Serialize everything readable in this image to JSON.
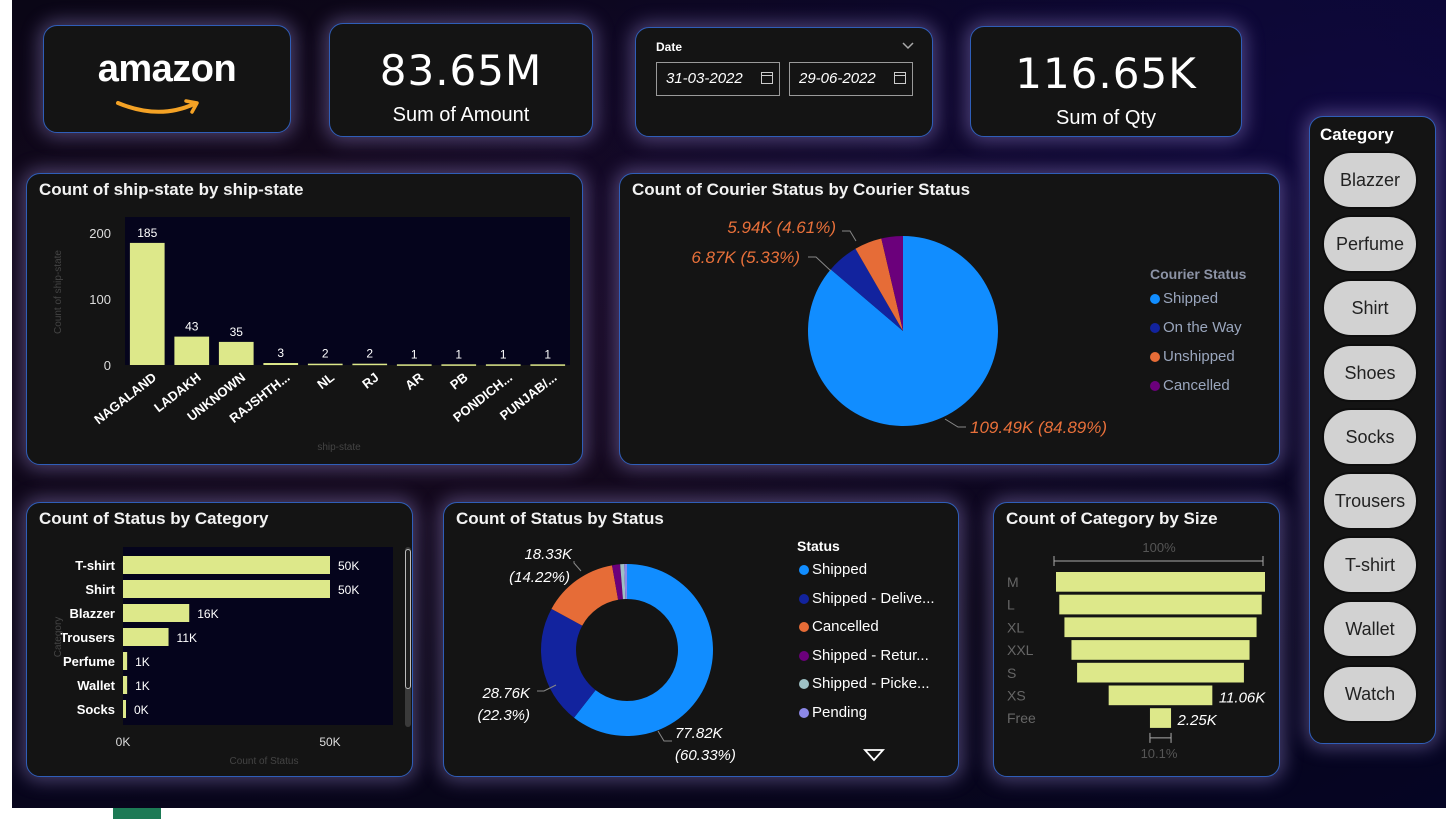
{
  "brand": {
    "logo_text": "amazon"
  },
  "kpis": {
    "amount": {
      "value": "83.65M",
      "label": "Sum of Amount"
    },
    "qty": {
      "value": "116.65K",
      "label": "Sum of Qty"
    }
  },
  "date_filter": {
    "label": "Date",
    "start": "31-03-2022",
    "end": "29-06-2022"
  },
  "category_slicer": {
    "title": "Category",
    "options": [
      "Blazzer",
      "Perfume",
      "Shirt",
      "Shoes",
      "Socks",
      "Trousers",
      "T-shirt",
      "Wallet",
      "Watch"
    ]
  },
  "colors": {
    "bar_fill": "#dde88a",
    "card_border": "#2f5eb8",
    "label_orange": "#e8703a"
  },
  "chart_data": [
    {
      "id": "ship_state",
      "type": "bar",
      "title": "Count of ship-state by ship-state",
      "xlabel": "ship-state",
      "ylabel": "Count of ship-state",
      "categories": [
        "NAGALAND",
        "LADAKH",
        "UNKNOWN",
        "RAJSHTH...",
        "NL",
        "RJ",
        "AR",
        "PB",
        "PONDICH...",
        "PUNJAB/..."
      ],
      "values": [
        185,
        43,
        35,
        3,
        2,
        2,
        1,
        1,
        1,
        1
      ],
      "data_labels": [
        "185",
        "43",
        "35",
        "3",
        "2",
        "2",
        "1",
        "1",
        "1",
        "1"
      ],
      "yticks": [
        "0",
        "100",
        "200"
      ],
      "ylim": [
        0,
        200
      ],
      "grid": false
    },
    {
      "id": "courier_status",
      "type": "pie",
      "title": "Count of Courier Status by Courier Status",
      "legend_title": "Courier Status",
      "legend_position": "right",
      "slices": [
        {
          "name": "Shipped",
          "value": 109490,
          "color": "#118dff",
          "label": "109.49K (84.89%)"
        },
        {
          "name": "On the Way",
          "value": 6870,
          "color": "#12239e",
          "label": "6.87K (5.33%)"
        },
        {
          "name": "Unshipped",
          "value": 5940,
          "color": "#e66c37",
          "label": "5.94K (4.61%)"
        },
        {
          "name": "Cancelled",
          "value": 4650,
          "color": "#6b007b",
          "label": ""
        }
      ]
    },
    {
      "id": "status_category",
      "type": "bar",
      "orientation": "horizontal",
      "title": "Count of Status by Category",
      "xlabel": "Count of Status",
      "ylabel": "Category",
      "categories": [
        "T-shirt",
        "Shirt",
        "Blazzer",
        "Trousers",
        "Perfume",
        "Wallet",
        "Socks"
      ],
      "values": [
        50000,
        50000,
        16000,
        11000,
        1000,
        1000,
        0
      ],
      "data_labels": [
        "50K",
        "50K",
        "16K",
        "11K",
        "1K",
        "1K",
        "0K"
      ],
      "xticks": [
        "0K",
        "50K"
      ],
      "xlim": [
        0,
        55000
      ]
    },
    {
      "id": "status_status",
      "type": "pie",
      "donut": true,
      "title": "Count of Status by Status",
      "legend_title": "Status",
      "legend_position": "right",
      "slices": [
        {
          "name": "Shipped",
          "value": 77820,
          "color": "#118dff",
          "label_a": "77.82K",
          "label_b": "(60.33%)"
        },
        {
          "name": "Shipped - Delive...",
          "value": 28760,
          "color": "#12239e",
          "label_a": "28.76K",
          "label_b": "(22.3%)"
        },
        {
          "name": "Cancelled",
          "value": 18330,
          "color": "#e66c37",
          "label_a": "18.33K",
          "label_b": "(14.22%)"
        },
        {
          "name": "Shipped - Retur...",
          "value": 1950,
          "color": "#6b007b",
          "label_a": "",
          "label_b": ""
        },
        {
          "name": "Shipped - Picke...",
          "value": 970,
          "color": "#9ec1c5",
          "label_a": "",
          "label_b": ""
        },
        {
          "name": "Pending",
          "value": 660,
          "color": "#8c88e8",
          "label_a": "",
          "label_b": ""
        }
      ]
    },
    {
      "id": "category_size",
      "type": "funnel",
      "title": "Count of Category by Size",
      "categories": [
        "M",
        "L",
        "XL",
        "XXL",
        "S",
        "XS",
        "Free"
      ],
      "values": [
        22300,
        21600,
        20500,
        19000,
        17800,
        11060,
        2250
      ],
      "data_labels": [
        "",
        "",
        "",
        "",
        "",
        "11.06K",
        "2.25K"
      ],
      "top_label": "100%",
      "bottom_label": "10.1%"
    }
  ]
}
